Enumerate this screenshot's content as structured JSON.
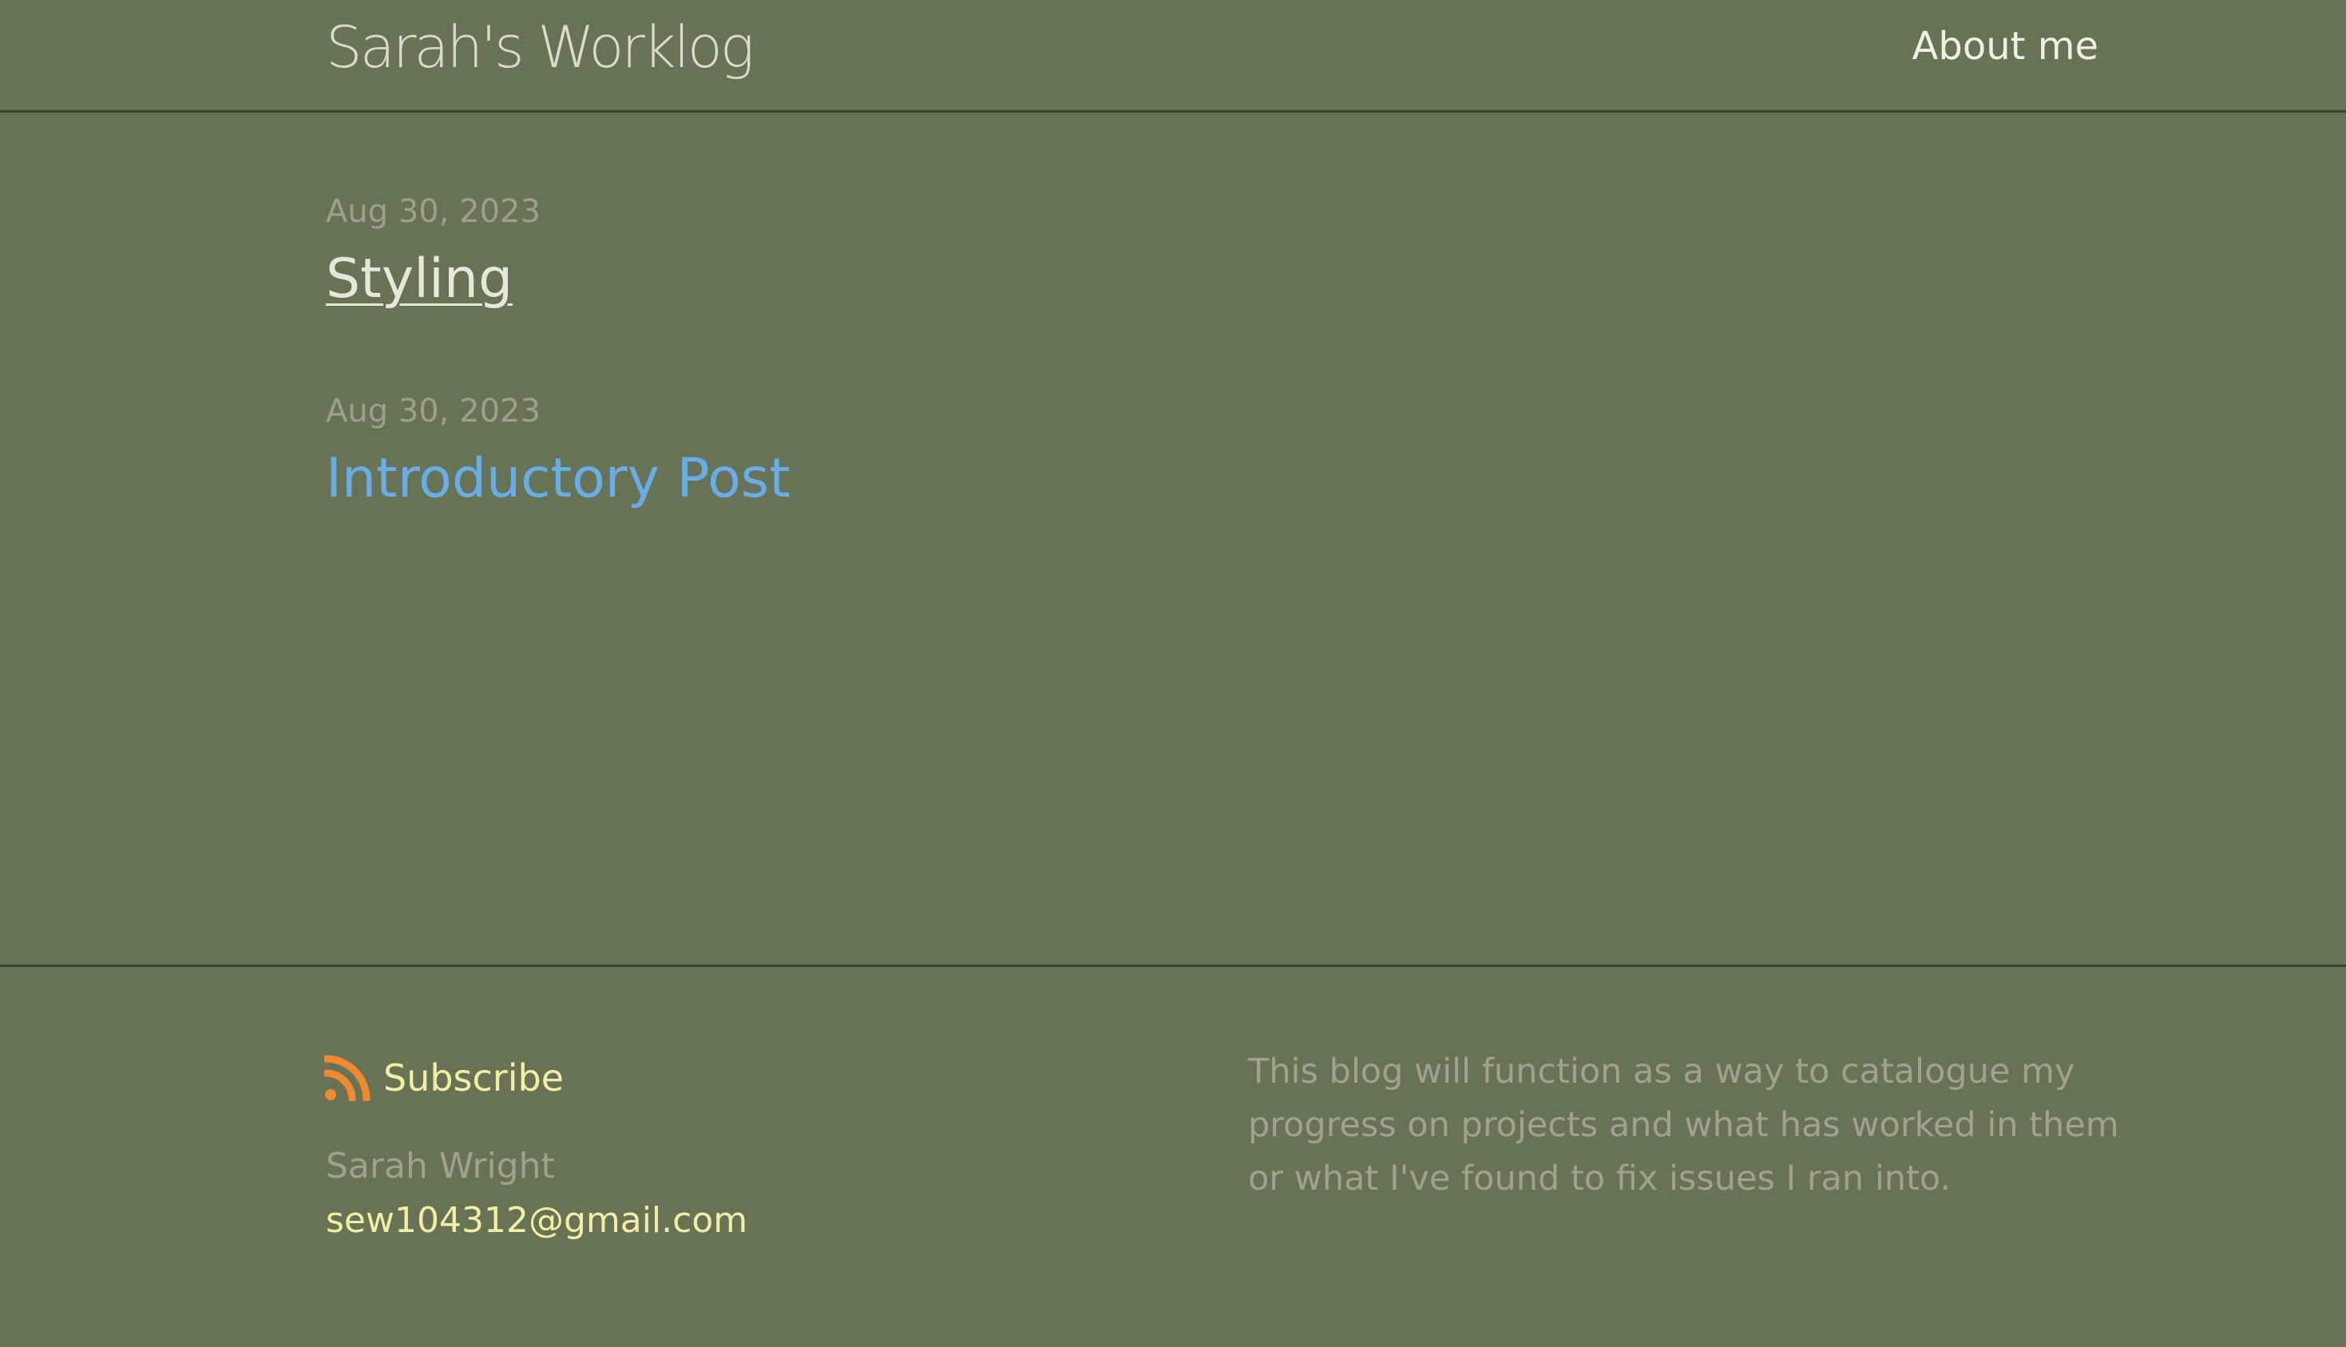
{
  "header": {
    "site_title": "Sarah's Worklog",
    "nav": [
      {
        "label": "About me"
      }
    ]
  },
  "posts": [
    {
      "date": "Aug 30, 2023",
      "title": "Styling",
      "visited": true
    },
    {
      "date": "Aug 30, 2023",
      "title": "Introductory Post",
      "visited": false
    }
  ],
  "footer": {
    "subscribe_label": "Subscribe",
    "subscribe_icon": "rss-icon",
    "author_name": "Sarah Wright",
    "author_email": "sew104312@gmail.com",
    "description": "This blog will function as a way to catalogue my progress on projects and what has worked in them or what I've found to fix issues I ran into."
  },
  "colors": {
    "background": "#687254",
    "divider": "#3b4130",
    "link": "#67ade8",
    "visited_link": "#e5e7db",
    "muted_text": "#9ea08a",
    "footer_link": "#f3eea6",
    "rss": "#f0892f"
  }
}
